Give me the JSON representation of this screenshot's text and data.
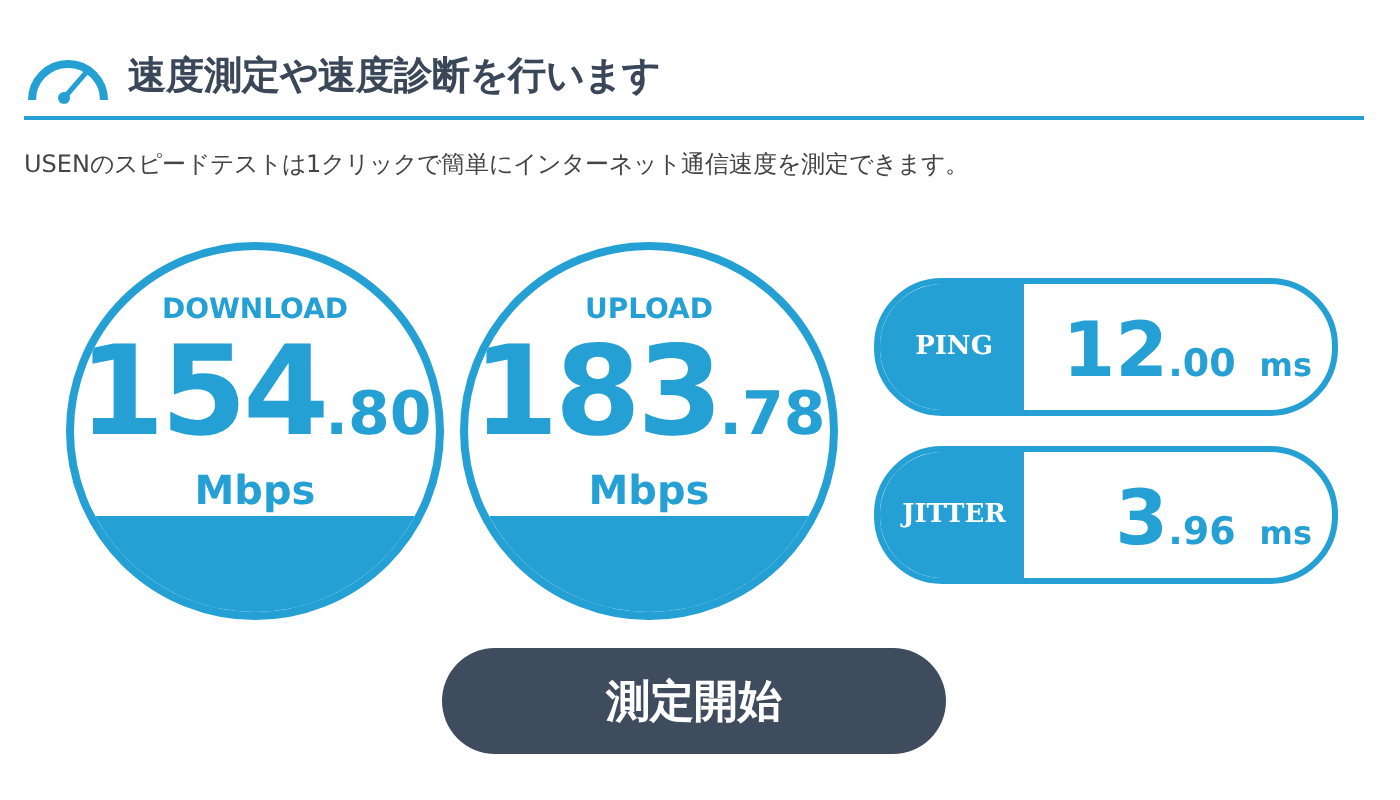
{
  "header": {
    "title": "速度測定や速度診断を行います"
  },
  "description": "USENのスピードテストは1クリックで簡単にインターネット通信速度を測定できます。",
  "gauges": [
    {
      "label": "DOWNLOAD",
      "integer": "154",
      "decimal": ".80",
      "unit": "Mbps"
    },
    {
      "label": "UPLOAD",
      "integer": "183",
      "decimal": ".78",
      "unit": "Mbps"
    }
  ],
  "metrics": [
    {
      "label": "PING",
      "integer": "12",
      "decimal": ".00",
      "unit": "ms"
    },
    {
      "label": "JITTER",
      "integer": "3",
      "decimal": ".96",
      "unit": "ms"
    }
  ],
  "start_button": "測定開始"
}
